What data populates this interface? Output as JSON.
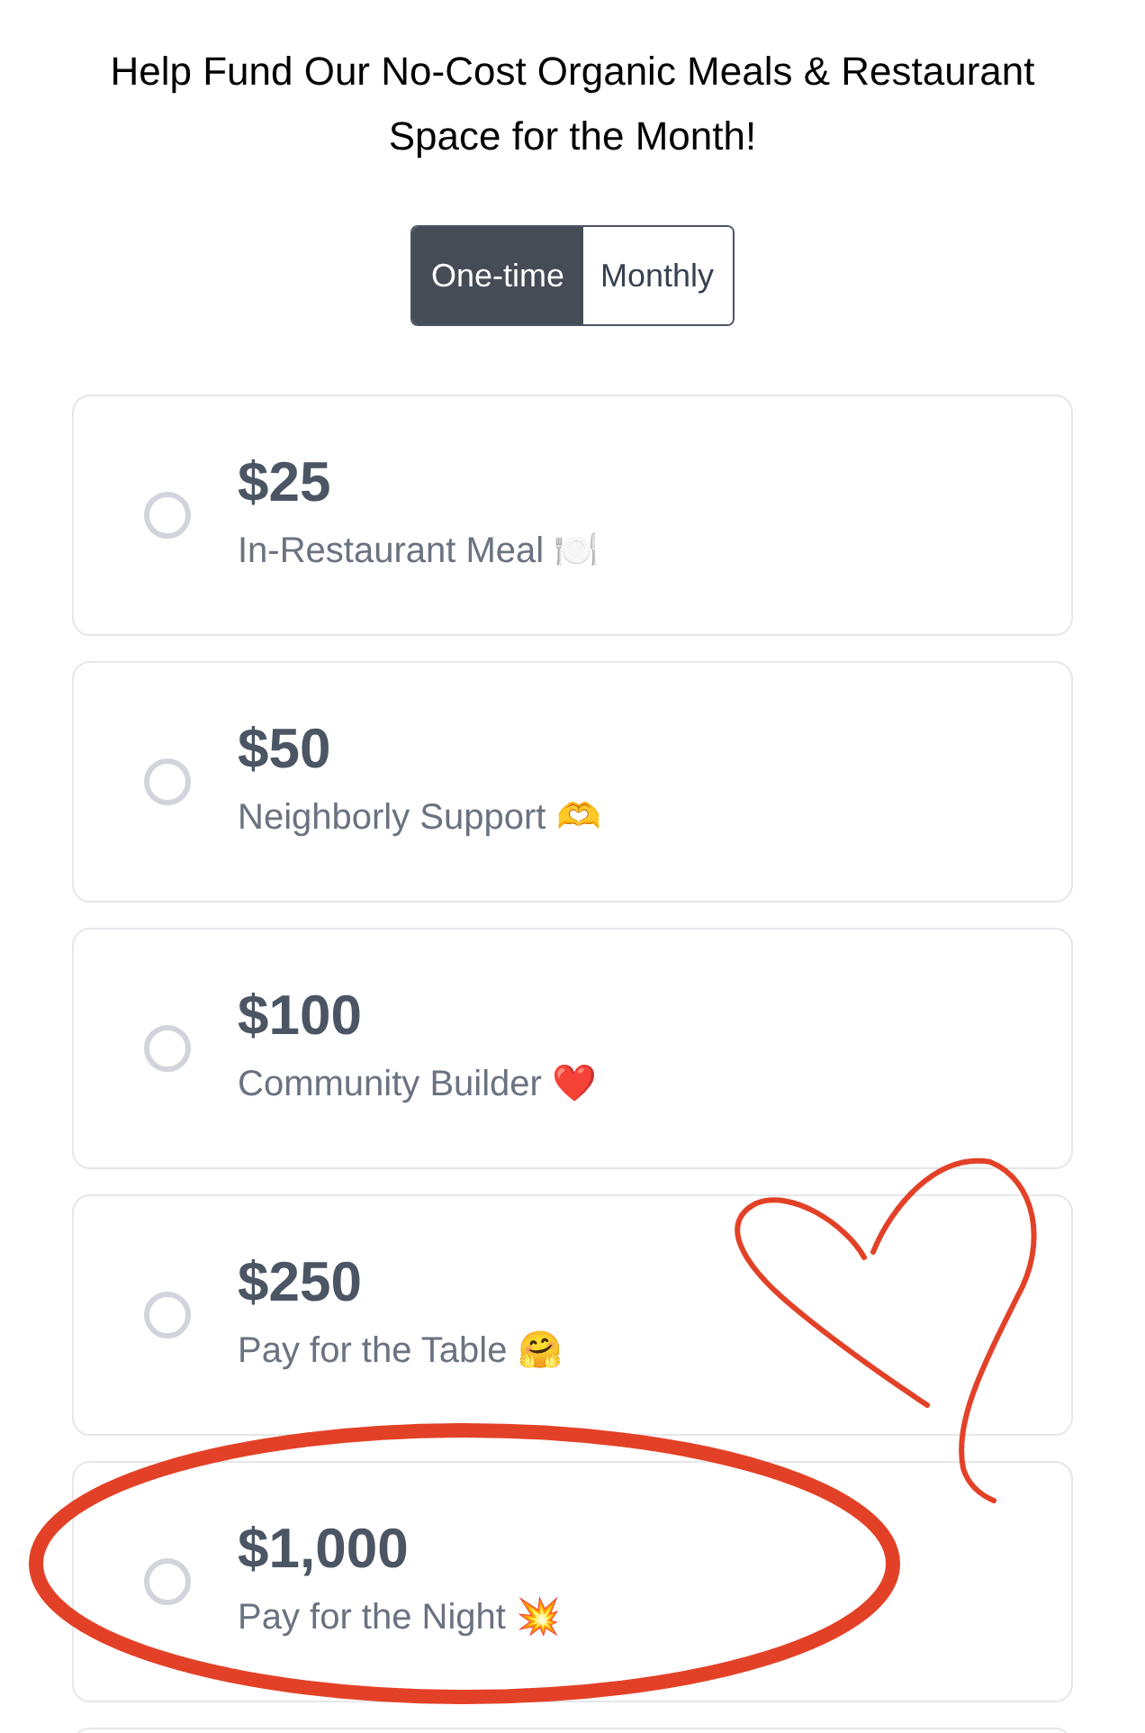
{
  "title": "Help Fund Our No-Cost Organic Meals & Restaurant Space for the Month!",
  "frequency_tabs": [
    {
      "label": "One-time",
      "selected": true
    },
    {
      "label": "Monthly",
      "selected": false
    }
  ],
  "options": [
    {
      "amount": "$25",
      "description": "In-Restaurant Meal 🍽️",
      "selected": false
    },
    {
      "amount": "$50",
      "description": "Neighborly Support 🫶",
      "selected": false
    },
    {
      "amount": "$100",
      "description": "Community Builder ❤️",
      "selected": false
    },
    {
      "amount": "$250",
      "description": "Pay for the Table 🤗",
      "selected": false
    },
    {
      "amount": "$1,000",
      "description": "Pay for the Night 💥",
      "selected": false
    }
  ]
}
